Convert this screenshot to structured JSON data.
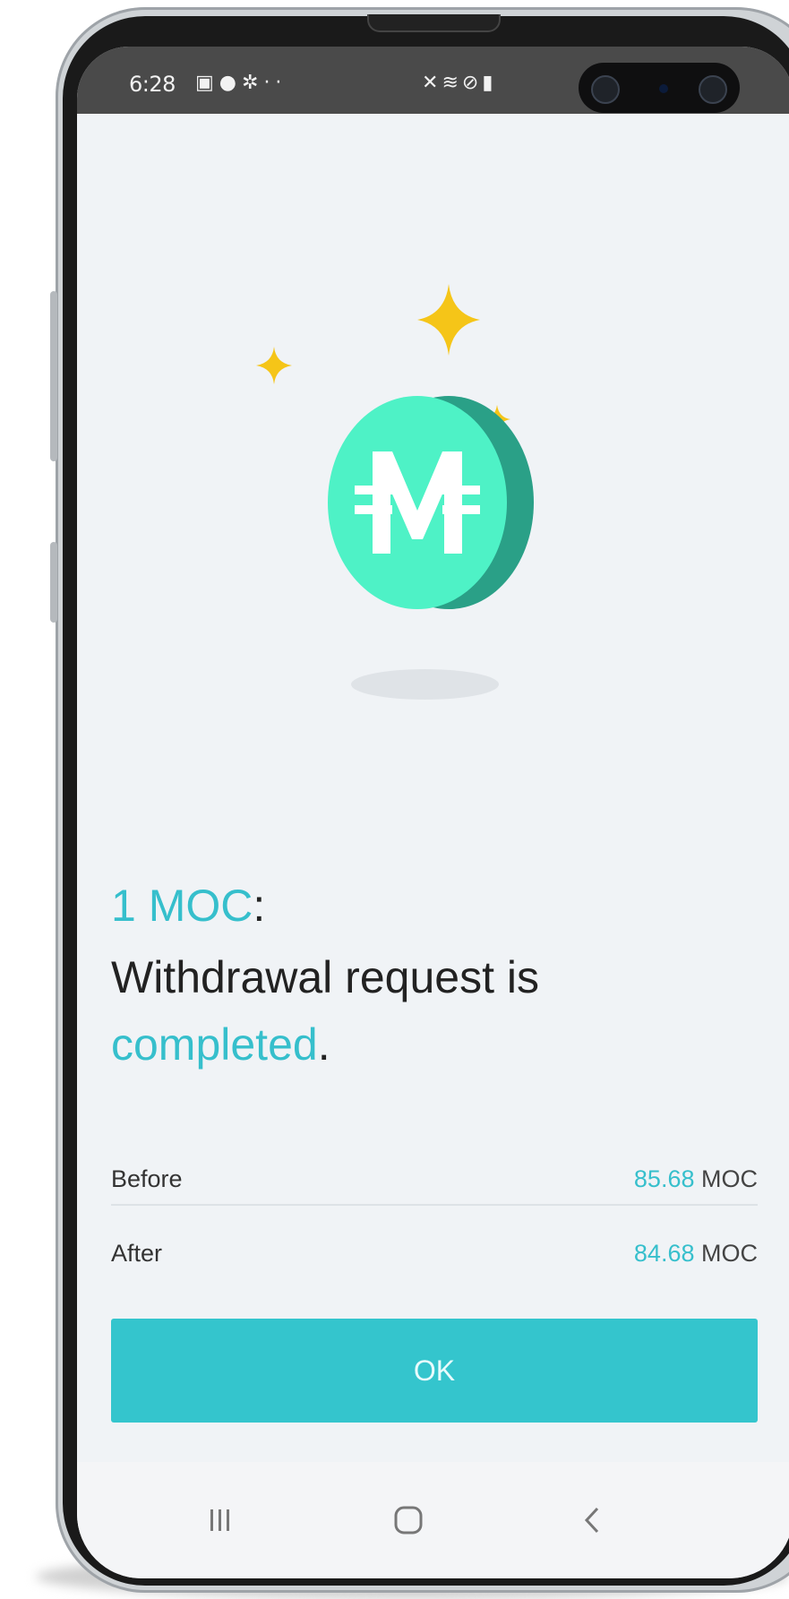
{
  "status_bar": {
    "time": "6:28",
    "left_icons": [
      "gallery-icon",
      "shopping-bag-icon",
      "settings-icon",
      "more-icon"
    ],
    "right_icons": [
      "mute-icon",
      "wifi-icon",
      "no-signal-icon",
      "battery-icon"
    ]
  },
  "message": {
    "amount": "1 MOC",
    "amount_suffix": ":",
    "line2": "Withdrawal request is",
    "status_word": "completed",
    "status_suffix": "."
  },
  "balances": {
    "before": {
      "label": "Before",
      "value": "85.68",
      "unit": "MOC"
    },
    "after": {
      "label": "After",
      "value": "84.68",
      "unit": "MOC"
    }
  },
  "ok_button": {
    "label": "OK"
  },
  "nav": {
    "items": [
      "recent-apps-icon",
      "home-icon",
      "back-icon"
    ]
  },
  "colors": {
    "accent": "#36bfcc",
    "button": "#34c5cd",
    "coin": "#4ef2c6",
    "coin_edge": "#2aa087",
    "sparkle": "#f5c518",
    "background": "#f0f3f6"
  }
}
